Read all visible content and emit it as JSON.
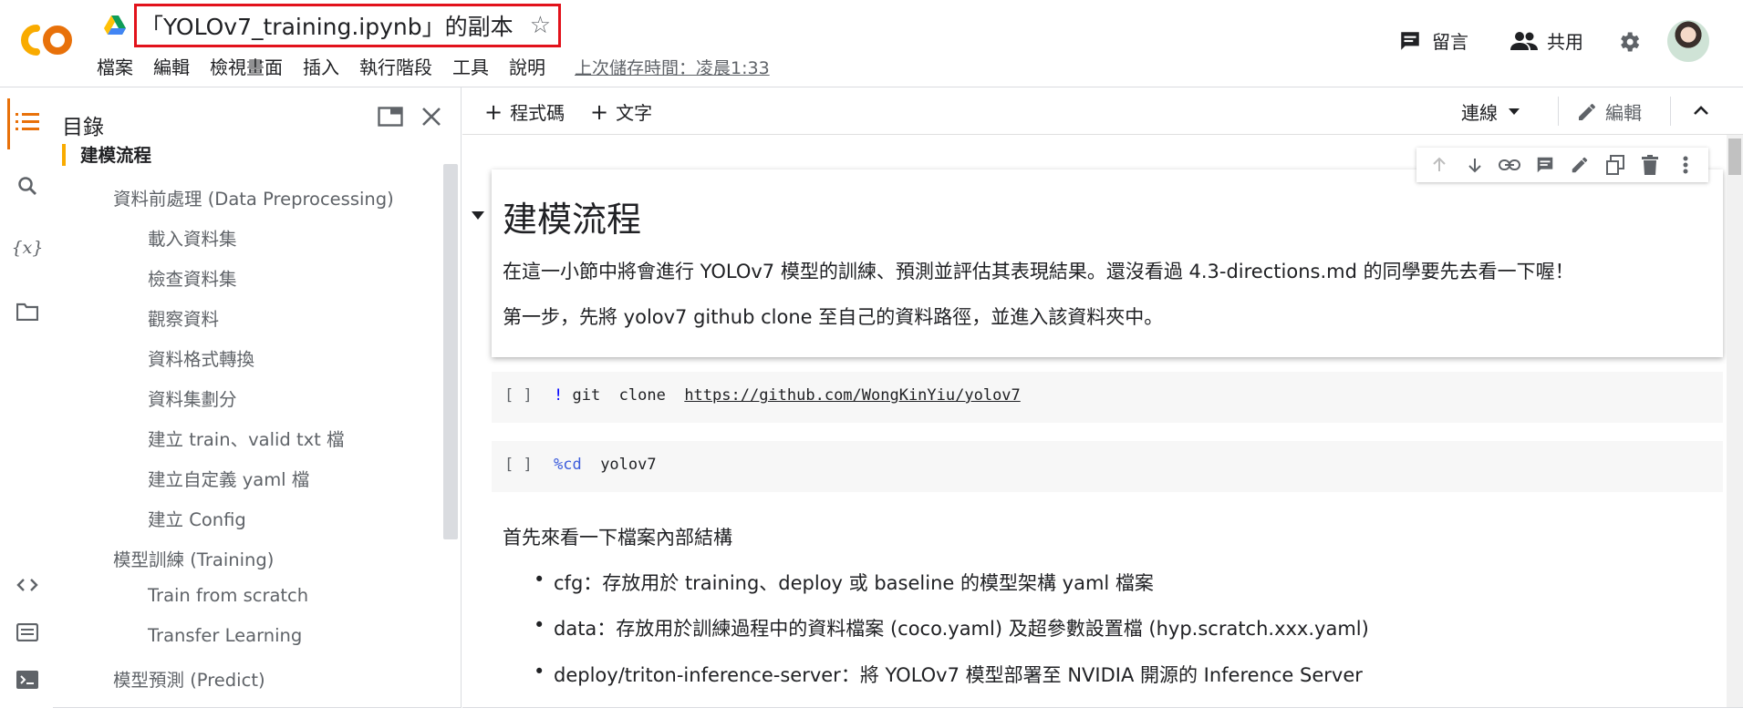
{
  "app": {
    "title": "「YOLOv7_training.ipynb」的副本",
    "last_saved": "上次儲存時間：凌晨1:33"
  },
  "menu": [
    "檔案",
    "編輯",
    "檢視畫面",
    "插入",
    "執行階段",
    "工具",
    "說明"
  ],
  "header_right": {
    "comments_label": "留言",
    "share_label": "共用"
  },
  "toc": {
    "title": "目錄",
    "items": [
      {
        "label": "建模流程",
        "level": 1
      },
      {
        "label": "資料前處理 (Data Preprocessing)",
        "level": 2
      },
      {
        "label": "載入資料集",
        "level": 3
      },
      {
        "label": "檢查資料集",
        "level": 3
      },
      {
        "label": "觀察資料",
        "level": 3
      },
      {
        "label": "資料格式轉換",
        "level": 3
      },
      {
        "label": "資料集劃分",
        "level": 3
      },
      {
        "label": "建立 train、valid txt 檔",
        "level": 3
      },
      {
        "label": "建立自定義 yaml 檔",
        "level": 3
      },
      {
        "label": "建立 Config",
        "level": 3
      },
      {
        "label": "模型訓練 (Training)",
        "level": 2
      },
      {
        "label": "Train from scratch",
        "level": 3
      },
      {
        "label": "Transfer Learning",
        "level": 3
      },
      {
        "label": "模型預測 (Predict)",
        "level": 2
      }
    ]
  },
  "toolbar": {
    "add_code": "程式碼",
    "add_text": "文字",
    "connect": "連線",
    "edit": "編輯"
  },
  "notebook": {
    "heading": "建模流程",
    "para1": "在這一小節中將會進行 YOLOv7 模型的訓練、預測並評估其表現結果。還沒看過 4.3-directions.md 的同學要先去看一下喔！",
    "para2": "第一步，先將 yolov7 github clone 至自己的資料路徑，並進入該資料夾中。",
    "cell1": {
      "bracket": "[ ]",
      "bang": "!",
      "command": " git  clone  ",
      "link": "https://github.com/WongKinYiu/yolov7"
    },
    "cell2": {
      "bracket": "[ ]",
      "magic": "%cd",
      "arg": "  yolov7"
    },
    "structure_intro": "首先來看一下檔案內部結構",
    "bullets": [
      "cfg：存放用於 training、deploy 或 baseline 的模型架構 yaml 檔案",
      "data：存放用於訓練過程中的資料檔案 (coco.yaml) 及超參數設置檔 (hyp.scratch.xxx.yaml)",
      "deploy/triton-inference-server：將 YOLOv7 模型部署至 NVIDIA 開源的 Inference Server"
    ]
  },
  "colors": {
    "highlight_border": "#e2121b",
    "toc_current": "#f9ab00",
    "rail_active": "#e8710a"
  },
  "icons": [
    "colab-logo",
    "drive-icon",
    "star-icon",
    "comment-icon",
    "people-icon",
    "gear-icon",
    "toc-icon",
    "search-icon",
    "variables-icon",
    "folder-icon",
    "code-snippets-icon",
    "command-palette-icon",
    "terminal-icon"
  ]
}
